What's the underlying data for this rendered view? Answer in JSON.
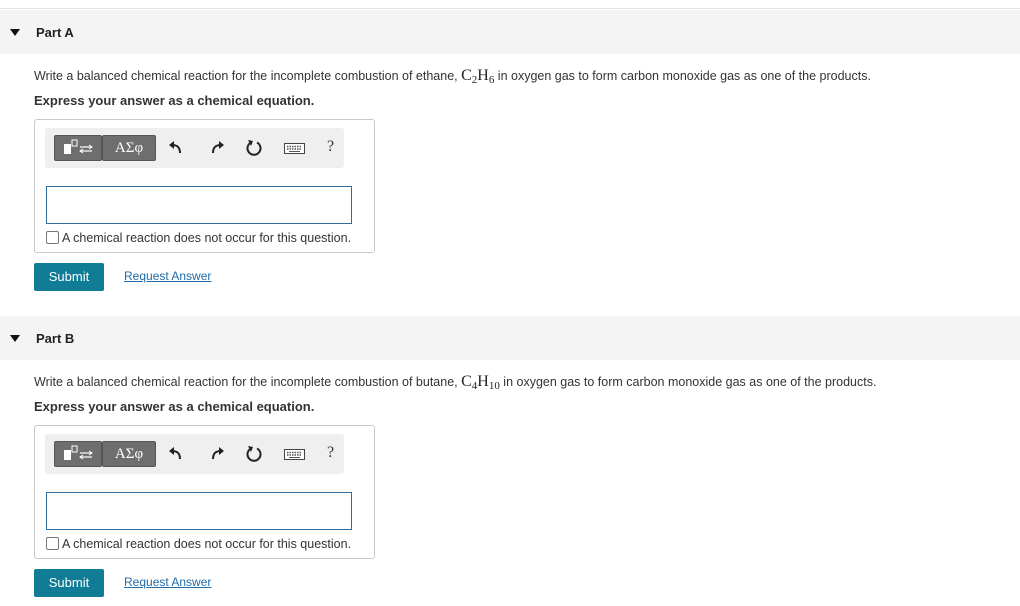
{
  "parts": [
    {
      "title": "Part A",
      "question_prefix": "Write a balanced chemical reaction for the incomplete combustion of ethane, ",
      "formula": {
        "e1": "C",
        "n1": "2",
        "e2": "H",
        "n2": "6"
      },
      "question_suffix": " in oxygen gas to form carbon monoxide gas as one of the products.",
      "instruction": "Express your answer as a chemical equation.",
      "toolbar": {
        "greek_label": "ΑΣφ",
        "help_label": "?"
      },
      "answer_value": "",
      "checkbox_label": "A chemical reaction does not occur for this question.",
      "submit_label": "Submit",
      "request_label": "Request Answer"
    },
    {
      "title": "Part B",
      "question_prefix": "Write a balanced chemical reaction for the incomplete combustion of butane, ",
      "formula": {
        "e1": "C",
        "n1": "4",
        "e2": "H",
        "n2": "10"
      },
      "question_suffix": " in oxygen gas to form carbon monoxide gas as one of the products.",
      "instruction": "Express your answer as a chemical equation.",
      "toolbar": {
        "greek_label": "ΑΣφ",
        "help_label": "?"
      },
      "answer_value": "",
      "checkbox_label": "A chemical reaction does not occur for this question.",
      "submit_label": "Submit",
      "request_label": "Request Answer"
    }
  ],
  "colors": {
    "header_bg": "#f4f4f4",
    "submit_bg": "#107c95",
    "link": "#1f6aa8",
    "toolbar_button": "#6e6e6e",
    "input_border": "#2f6f9f"
  },
  "icons": [
    "expand-caret-icon",
    "template-icon",
    "undo-icon",
    "redo-icon",
    "reset-icon",
    "keyboard-icon"
  ]
}
